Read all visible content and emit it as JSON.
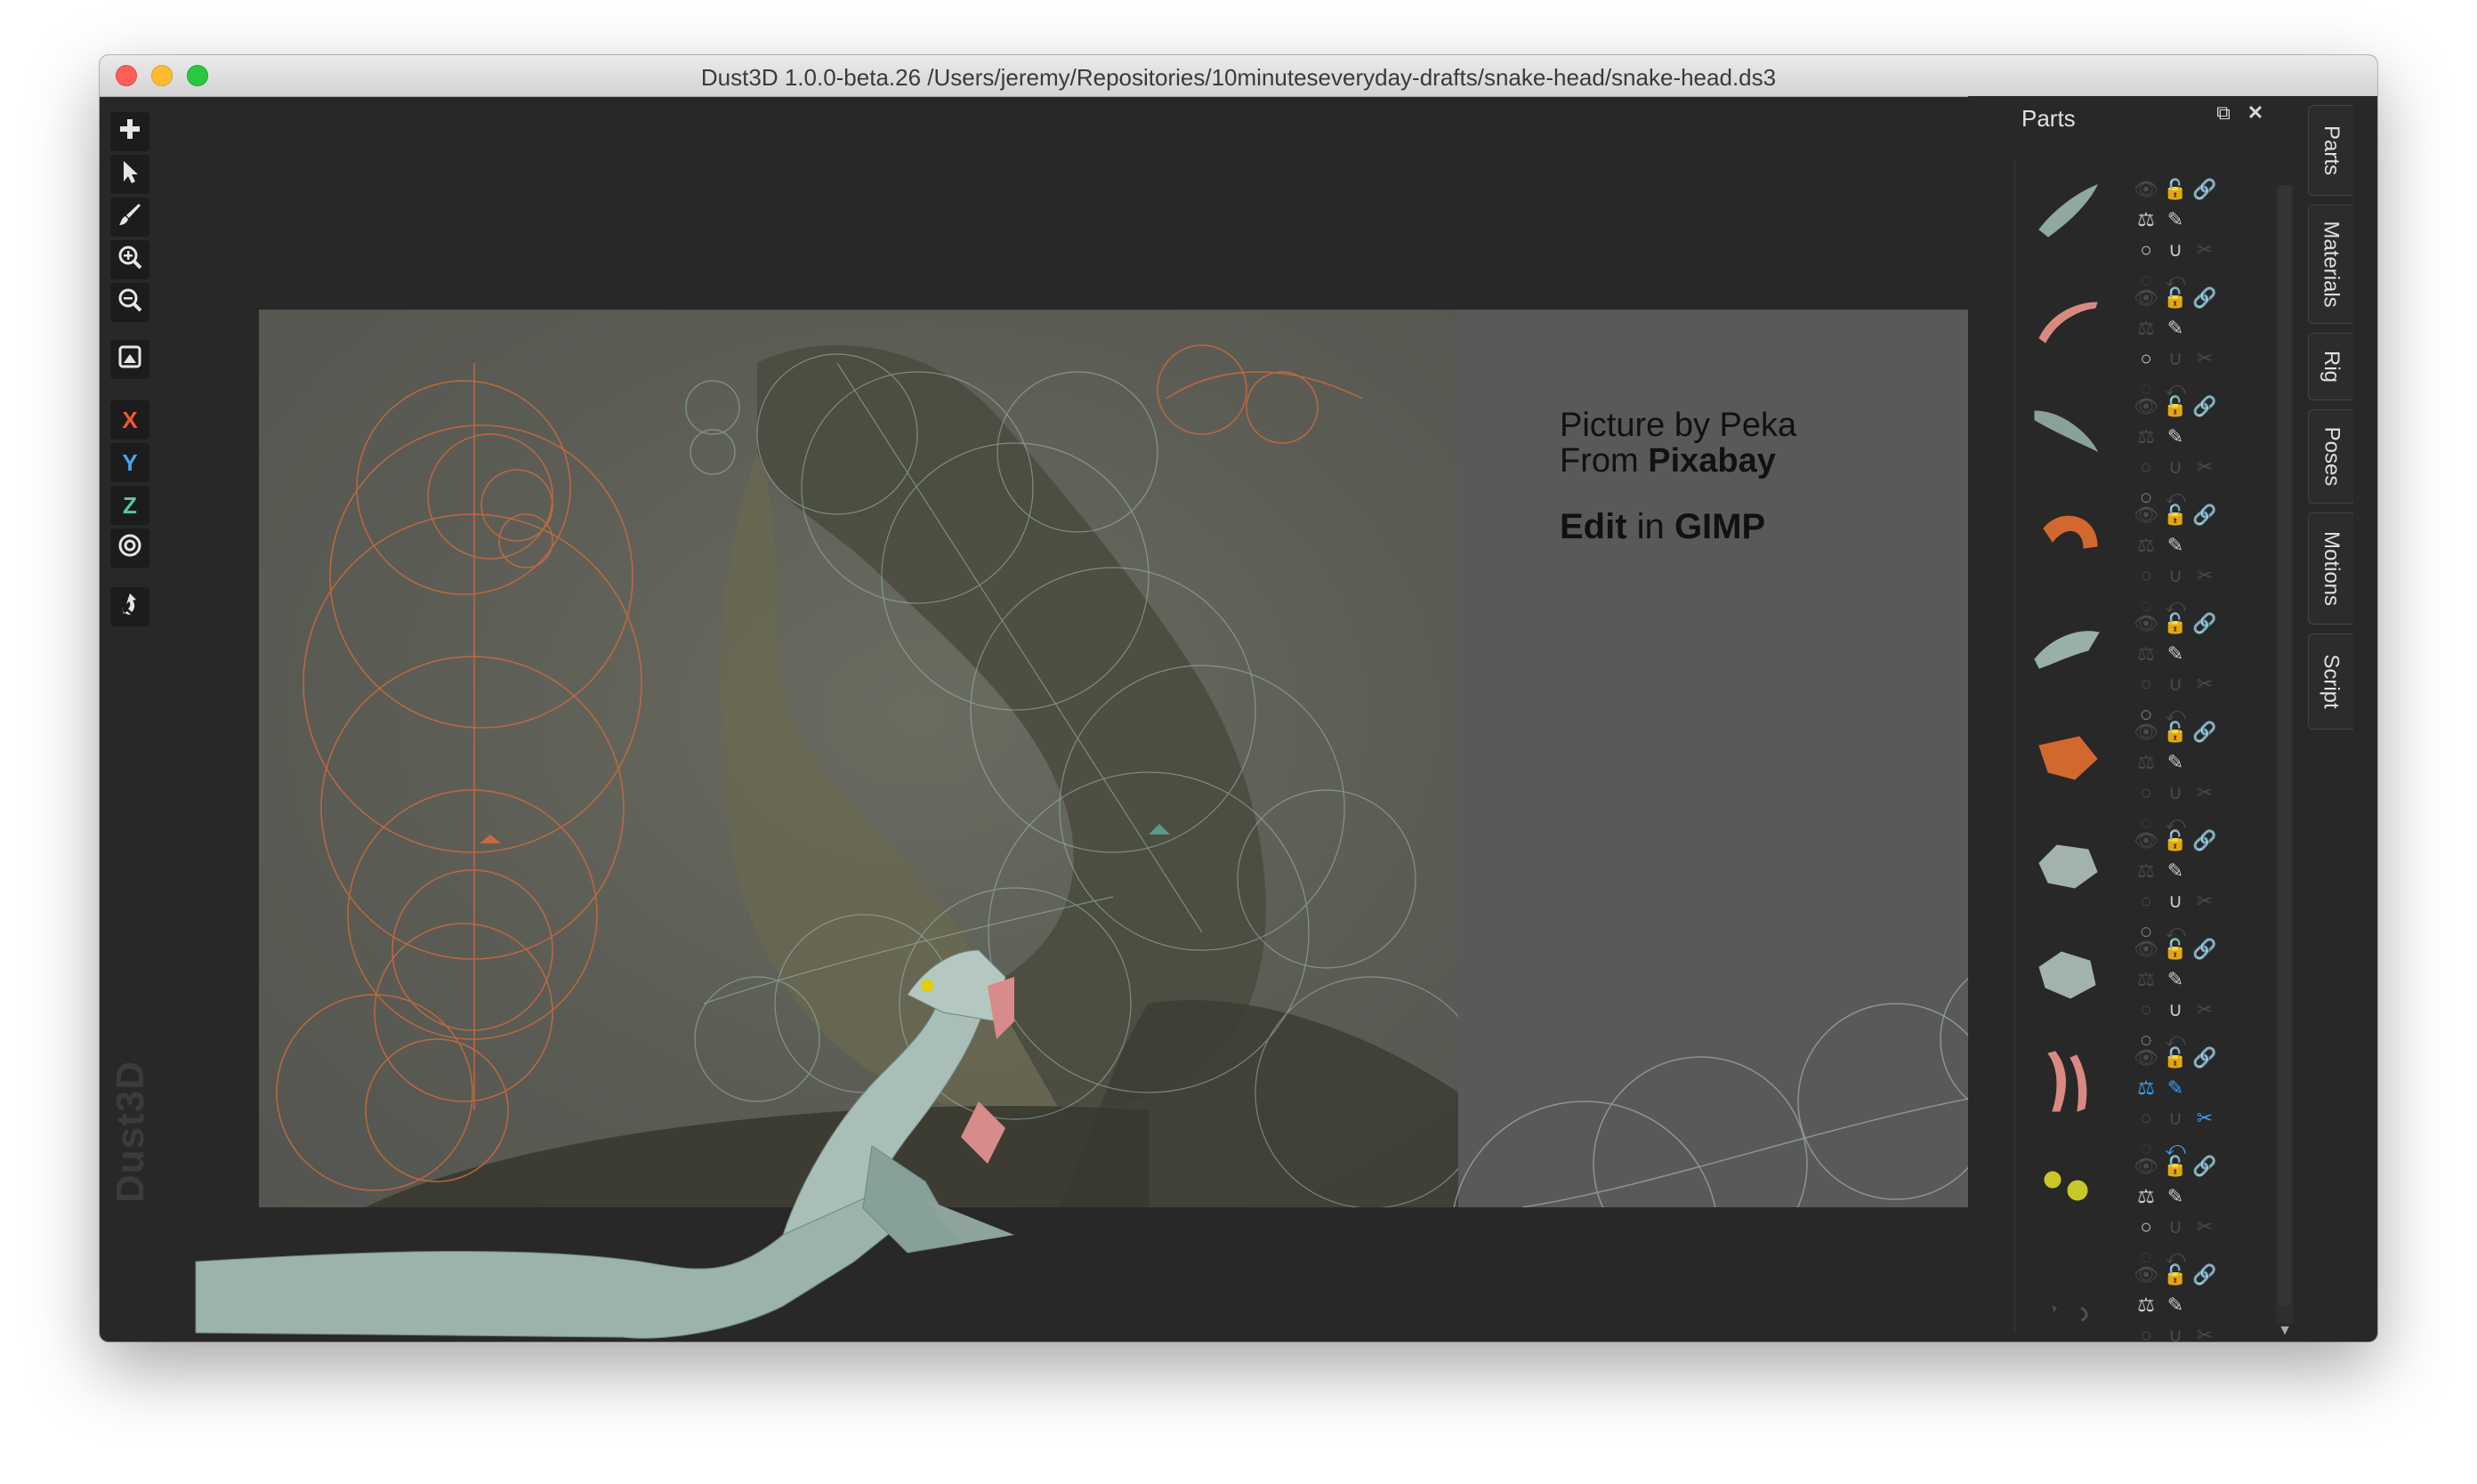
{
  "window": {
    "title": "Dust3D 1.0.0-beta.26 /Users/jeremy/Repositories/10minuteseveryday-drafts/snake-head/snake-head.ds3"
  },
  "toolbar": {
    "tools": [
      {
        "name": "add",
        "icon": "plus-icon"
      },
      {
        "name": "select",
        "icon": "pointer-icon"
      },
      {
        "name": "paint",
        "icon": "brush-icon"
      },
      {
        "name": "zoom-in",
        "icon": "zoom-in-icon"
      },
      {
        "name": "zoom-out",
        "icon": "zoom-out-icon"
      },
      {
        "name": "image",
        "icon": "image-icon"
      },
      {
        "name": "rotate",
        "icon": "recycle-icon"
      }
    ],
    "axes": {
      "x": "X",
      "y": "Y",
      "z": "Z"
    },
    "colors": {
      "x": "#f1582c",
      "y": "#4aa3f0",
      "z": "#56c9a3"
    }
  },
  "watermark": "Dust3D",
  "reference_image": {
    "line1_prefix": "Picture by Peka",
    "line2_prefix": "From",
    "line2_brand": "Pixabay",
    "edit_bold": "Edit",
    "edit_in": "in",
    "edit_app": "GIMP"
  },
  "parts_panel": {
    "title": "Parts",
    "parts": [
      {
        "thumb_color": "#8fa8a0",
        "shape": "fang",
        "selected": false,
        "active_icons": [
          "balance",
          "pick",
          "circle",
          "magnet"
        ]
      },
      {
        "thumb_color": "#d98a80",
        "shape": "curve",
        "selected": false,
        "active_icons": [
          "pick",
          "circle"
        ]
      },
      {
        "thumb_color": "#8aa09a",
        "shape": "jaw",
        "selected": false,
        "active_icons": [
          "pick",
          "dashed"
        ]
      },
      {
        "thumb_color": "#d3682e",
        "shape": "coil",
        "selected": false,
        "active_icons": [
          "pick"
        ]
      },
      {
        "thumb_color": "#98b0a8",
        "shape": "head",
        "selected": false,
        "active_icons": [
          "pick",
          "dashed"
        ]
      },
      {
        "thumb_color": "#d3682e",
        "shape": "block",
        "selected": false,
        "active_icons": [
          "pick"
        ]
      },
      {
        "thumb_color": "#a2b2ae",
        "shape": "rock",
        "selected": false,
        "active_icons": [
          "pick",
          "magnet",
          "dashed"
        ]
      },
      {
        "thumb_color": "#a2b2ae",
        "shape": "rock2",
        "selected": false,
        "active_icons": [
          "pick",
          "magnet",
          "dashed"
        ]
      },
      {
        "thumb_color": "#d98a80",
        "shape": "fangs",
        "selected": true,
        "active_icons": [
          "balance",
          "pick",
          "scissors",
          "sweep"
        ]
      },
      {
        "thumb_color": "#c8c828",
        "shape": "eyes",
        "selected": false,
        "active_icons": [
          "balance",
          "pick",
          "circle"
        ]
      },
      {
        "thumb_color": "#505050",
        "shape": "small",
        "selected": false,
        "active_icons": [
          "balance",
          "pick"
        ]
      }
    ]
  },
  "tabs": [
    "Parts",
    "Materials",
    "Rig",
    "Poses",
    "Motions",
    "Script"
  ]
}
